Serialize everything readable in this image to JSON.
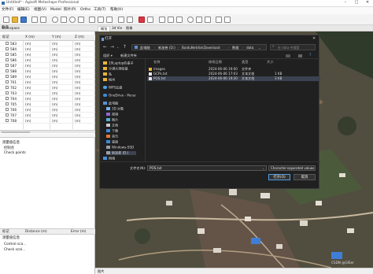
{
  "app": {
    "title": "Untitled* - Agisoft Metashape Professional"
  },
  "menubar": [
    "文件(F)",
    "编辑(E)",
    "视图(V)",
    "Model",
    "照片(P)",
    "Ortho",
    "工具(T)",
    "帮助(H)"
  ],
  "tabs": {
    "workspace": "Workspace",
    "main_tabs": [
      "概览",
      "3d Vie",
      "图像"
    ]
  },
  "left_panel": {
    "reference_header": "参考",
    "columns": [
      "标记",
      "X (m)",
      "Y (m)",
      "Z (m)"
    ],
    "markers": [
      {
        "name": "583",
        "x_unit": "(m)",
        "y_unit": "(m)",
        "z_unit": "(m)"
      },
      {
        "name": "584",
        "x_unit": "(m)",
        "y_unit": "(m)",
        "z_unit": "(m)"
      },
      {
        "name": "585",
        "x_unit": "(m)",
        "y_unit": "(m)",
        "z_unit": "(m)"
      },
      {
        "name": "586",
        "x_unit": "(m)",
        "y_unit": "(m)",
        "z_unit": "(m)"
      },
      {
        "name": "587",
        "x_unit": "(m)",
        "y_unit": "(m)",
        "z_unit": "(m)"
      },
      {
        "name": "588",
        "x_unit": "(m)",
        "y_unit": "(m)",
        "z_unit": "(m)"
      },
      {
        "name": "589",
        "x_unit": "(m)",
        "y_unit": "(m)",
        "z_unit": "(m)"
      },
      {
        "name": "701",
        "x_unit": "(m)",
        "y_unit": "(m)",
        "z_unit": "(m)"
      },
      {
        "name": "702",
        "x_unit": "(m)",
        "y_unit": "(m)",
        "z_unit": "(m)"
      },
      {
        "name": "703",
        "x_unit": "(m)",
        "y_unit": "(m)",
        "z_unit": "(m)"
      },
      {
        "name": "704",
        "x_unit": "(m)",
        "y_unit": "(m)",
        "z_unit": "(m)"
      },
      {
        "name": "705",
        "x_unit": "(m)",
        "y_unit": "(m)",
        "z_unit": "(m)"
      },
      {
        "name": "706",
        "x_unit": "(m)",
        "y_unit": "(m)",
        "z_unit": "(m)"
      },
      {
        "name": "707",
        "x_unit": "(m)",
        "y_unit": "(m)",
        "z_unit": "(m)"
      },
      {
        "name": "708",
        "x_unit": "(m)",
        "y_unit": "(m)",
        "z_unit": "(m)"
      }
    ],
    "section2_header": "测量值信息",
    "section2_items": [
      "控制点",
      "Check points"
    ],
    "section3_header": "测量值信息",
    "section3_items": [
      "控制点",
      "Check points"
    ],
    "bottom_columns": [
      "标记",
      "Distance (m)",
      "Error (m)"
    ],
    "bottom_rows": [
      "Control sca...",
      "Check scal..."
    ]
  },
  "dialog": {
    "title": "打开",
    "path_segments": [
      "此电脑",
      "新加卷 (D:)",
      "BaiduNetdiskDownload",
      "数据",
      "data"
    ],
    "search_placeholder": "在 data 中搜索",
    "cmd_organize": "组织 ▾",
    "cmd_new_folder": "新建文件夹",
    "sidebar": [
      {
        "label": "19Laptop的桌子",
        "icon": "folder"
      },
      {
        "label": "沙漠大测绘基",
        "icon": "folder"
      },
      {
        "label": "私",
        "icon": "folder"
      },
      {
        "label": "梅州",
        "icon": "folder"
      },
      {
        "label": "WPS云盘",
        "icon": "cloud"
      },
      {
        "label": "OneDrive - Perso",
        "icon": "cloud"
      },
      {
        "label": "此电脑",
        "icon": "pc"
      },
      {
        "label": "3D 对象",
        "icon": "cube"
      },
      {
        "label": "视频",
        "icon": "video"
      },
      {
        "label": "图片",
        "icon": "picture"
      },
      {
        "label": "文档",
        "icon": "document"
      },
      {
        "label": "下载",
        "icon": "download"
      },
      {
        "label": "音乐",
        "icon": "music"
      },
      {
        "label": "桌面",
        "icon": "desktop"
      },
      {
        "label": "Windows-SSD",
        "icon": "drive"
      },
      {
        "label": "新加卷 (D:)",
        "icon": "drive"
      },
      {
        "label": "网络",
        "icon": "network"
      }
    ],
    "columns": [
      "名称",
      "修改日期",
      "类型",
      "大小"
    ],
    "files": [
      {
        "name": "images",
        "date": "2024-06-06 19:00",
        "type": "文件夹",
        "size": "",
        "icon": "folder"
      },
      {
        "name": "GCPs.txt",
        "date": "2024-06-06 17:03",
        "type": "文本文档",
        "size": "1 KB",
        "icon": "txt"
      },
      {
        "name": "POS.txt",
        "date": "2024-06-06 19:20",
        "type": "文本文档",
        "size": "3 KB",
        "icon": "txt"
      }
    ],
    "selected_file": "POS.txt",
    "filename_label": "文件名(N):",
    "filename_value": "POS.txt",
    "filetype_value": "Character-separated values",
    "open_button": "打开(O)",
    "cancel_button": "取消"
  },
  "statusbar": {
    "text": "图片"
  },
  "watermark": "CSDN @GISer"
}
